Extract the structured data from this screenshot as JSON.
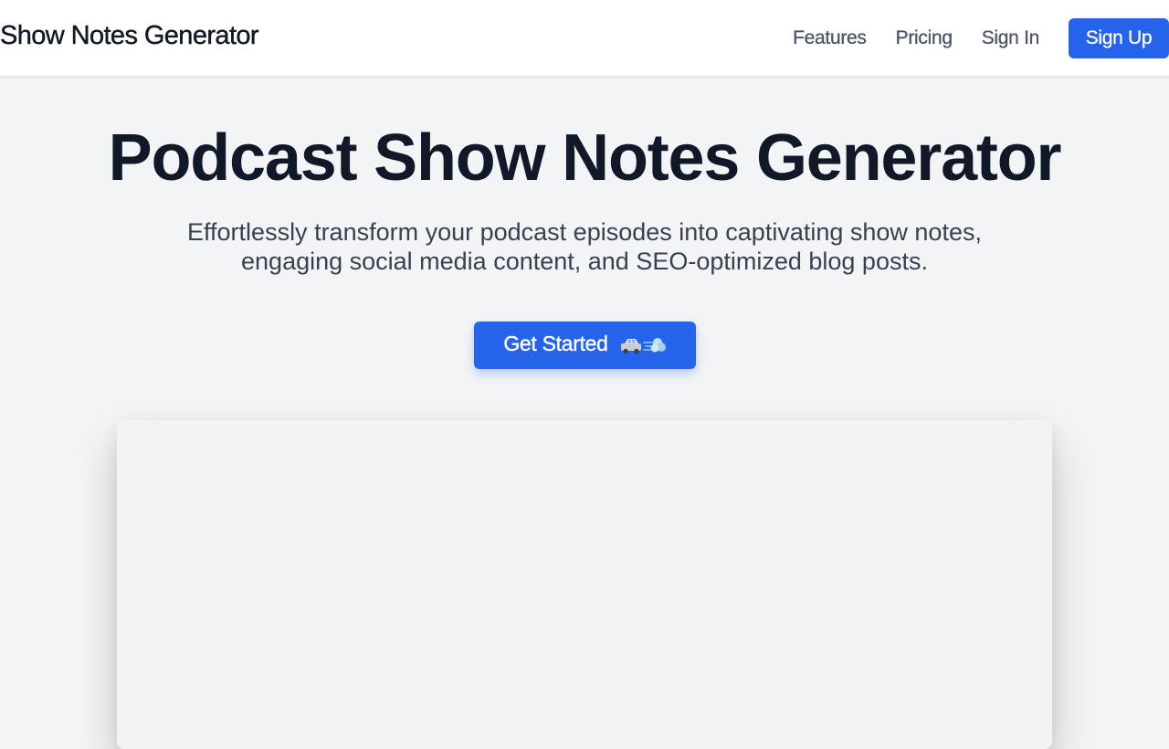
{
  "header": {
    "brand": "Show Notes Generator",
    "nav": [
      {
        "label": "Features"
      },
      {
        "label": "Pricing"
      },
      {
        "label": "Sign In"
      }
    ],
    "signup_label": "Sign Up"
  },
  "hero": {
    "title": "Podcast Show Notes Generator",
    "subtitle": "Effortlessly transform your podcast episodes into captivating show notes, engaging social media content, and SEO-optimized blog posts.",
    "cta_label": "Get Started",
    "cta_icons": [
      "car-icon",
      "dash-puff-icon"
    ]
  },
  "colors": {
    "accent": "#2563eb",
    "background": "#f2f4f6",
    "heading": "#111827",
    "body_text": "#374151",
    "nav_text": "#4b5563"
  }
}
